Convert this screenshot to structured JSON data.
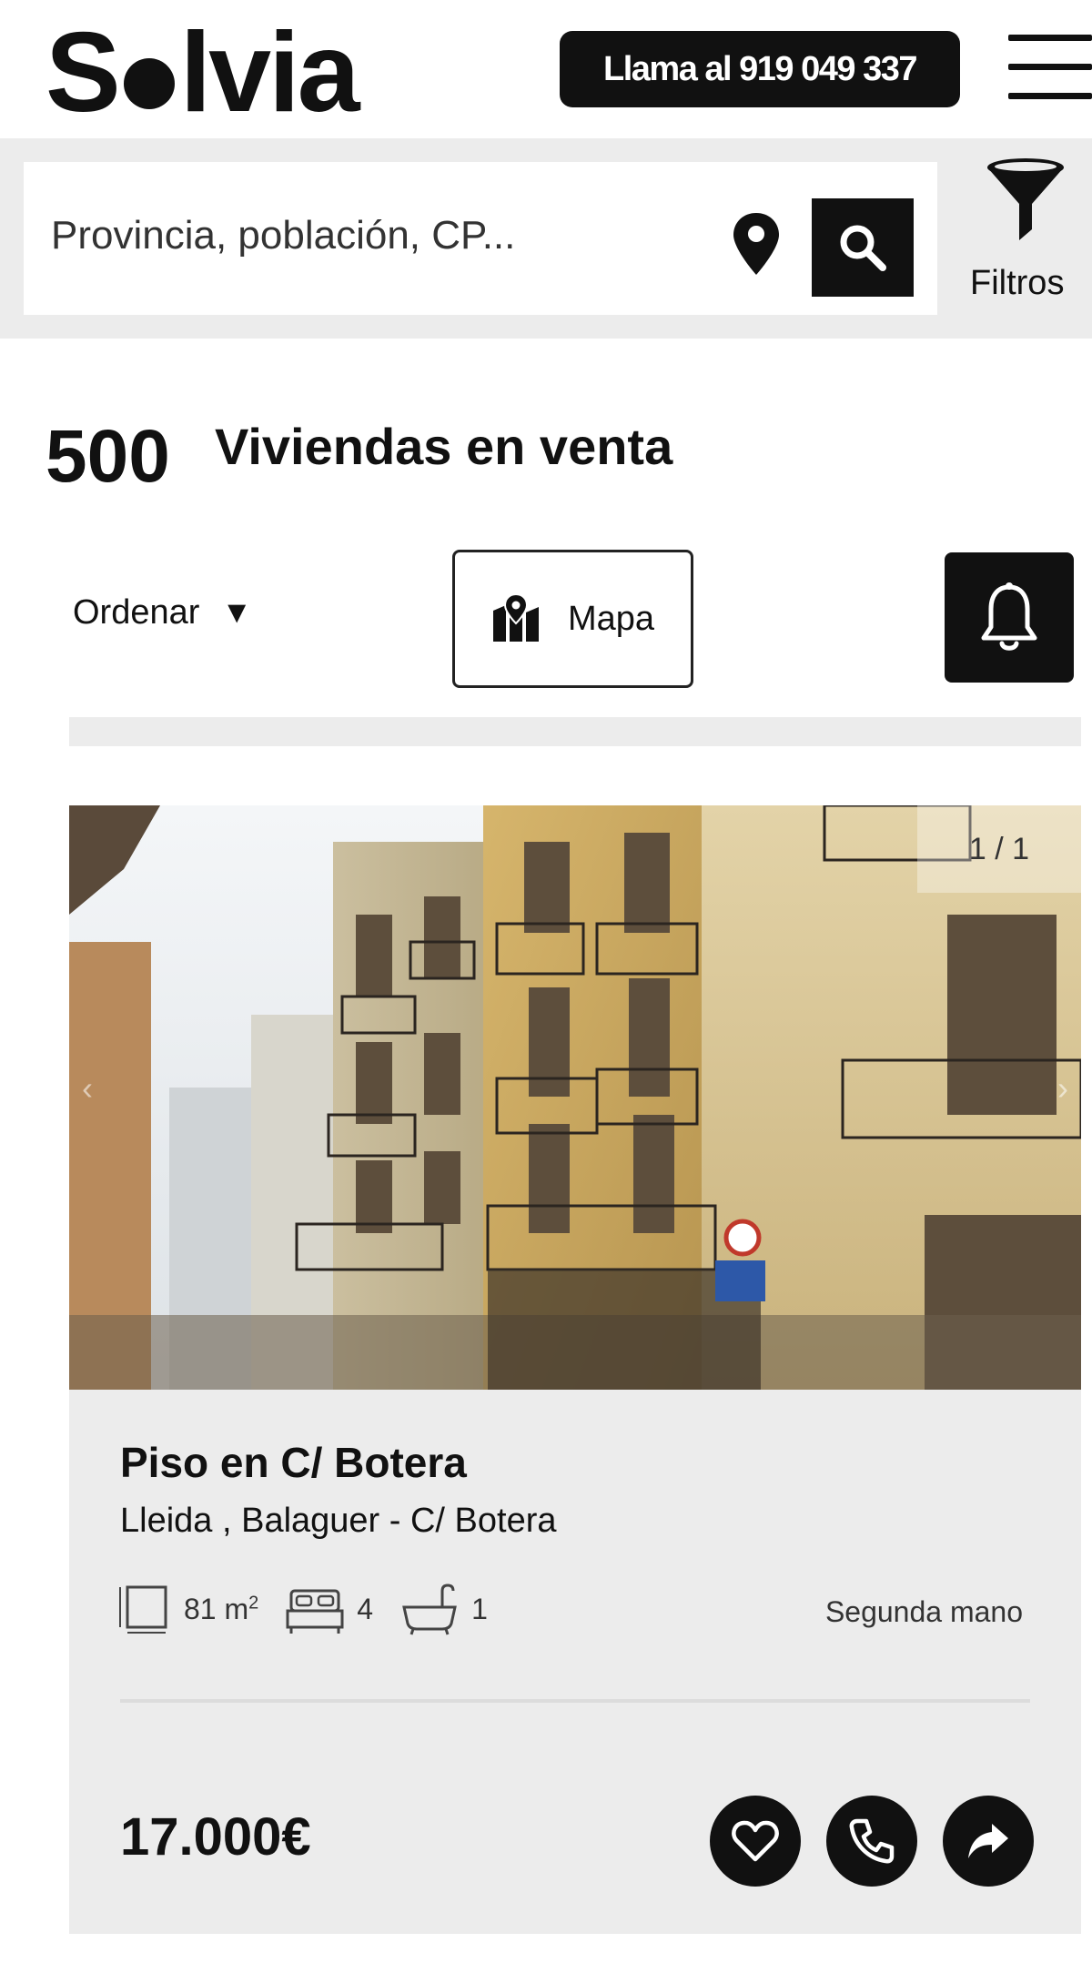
{
  "header": {
    "logo_text": "Solvia",
    "call_button_label": "Llama al 919 049 337",
    "menu_icon": "hamburger-menu-icon"
  },
  "search": {
    "placeholder": "Provincia, población, CP...",
    "location_icon": "map-pin-icon",
    "search_icon": "search-icon",
    "filters_label": "Filtros",
    "filters_icon": "funnel-icon"
  },
  "results": {
    "count": "500",
    "label": "Viviendas en venta"
  },
  "toolbar": {
    "sort_label": "Ordenar",
    "sort_caret": "▼",
    "map_label": "Mapa",
    "map_icon": "map-pin-icon",
    "alert_icon": "bell-icon"
  },
  "listing": {
    "image_counter": "1 / 1",
    "prev_arrow": "‹",
    "next_arrow": "›",
    "title": "Piso en C/ Botera",
    "location": "Lleida , Balaguer - C/ Botera",
    "area_value": "81 m",
    "area_sup": "2",
    "bedrooms": "4",
    "bathrooms": "1",
    "condition": "Segunda mano",
    "price": "17.000€",
    "actions": [
      "heart-icon",
      "phone-icon",
      "share-icon"
    ]
  },
  "colors": {
    "primary": "#111111",
    "band": "#ececec",
    "background": "#ffffff"
  }
}
